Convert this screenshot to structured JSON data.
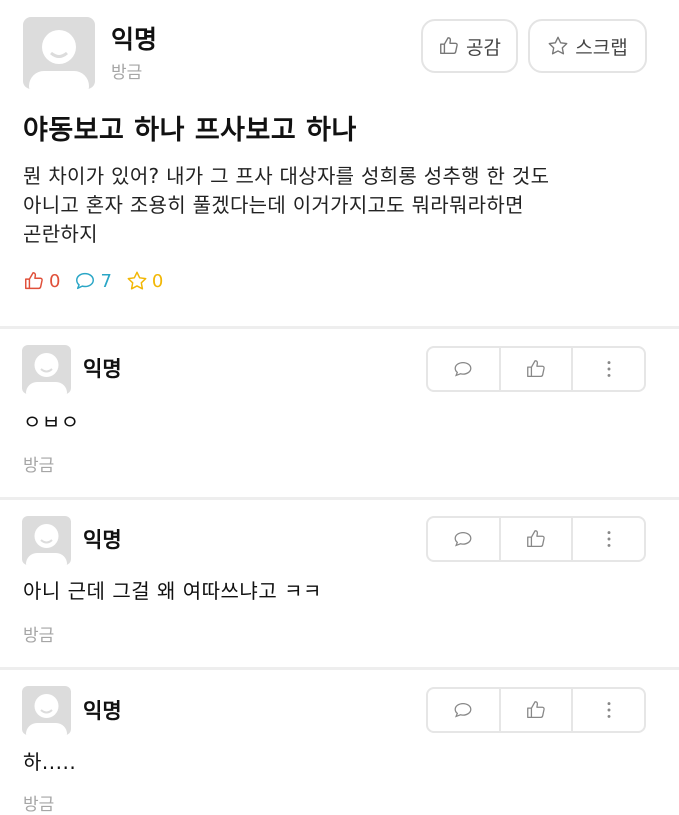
{
  "post": {
    "author": "익명",
    "time": "방금",
    "empathy_label": "공감",
    "scrap_label": "스크랩",
    "title": "야동보고 하나 프사보고 하나",
    "body_lines": [
      "뭔 차이가 있어? 내가 그 프사 대상자를 성희롱 성추행 한 것도",
      "아니고 혼자 조용히 풀겠다는데 이거가지고도 뭐라뭐라하면",
      "곤란하지"
    ],
    "likes": "0",
    "comments": "7",
    "scraps": "0"
  },
  "comments": [
    {
      "author": "익명",
      "text": "ㅇㅂㅇ",
      "time": "방금"
    },
    {
      "author": "익명",
      "text": "아니 근데 그걸 왜 여따쓰냐고 ㅋㅋ",
      "time": "방금"
    },
    {
      "author": "익명",
      "text": "하.....",
      "time": "방금"
    }
  ],
  "colors": {
    "like": "#e0503a",
    "comment": "#2aa6c6",
    "scrap": "#f2b705",
    "muted": "#a6a6a6"
  }
}
